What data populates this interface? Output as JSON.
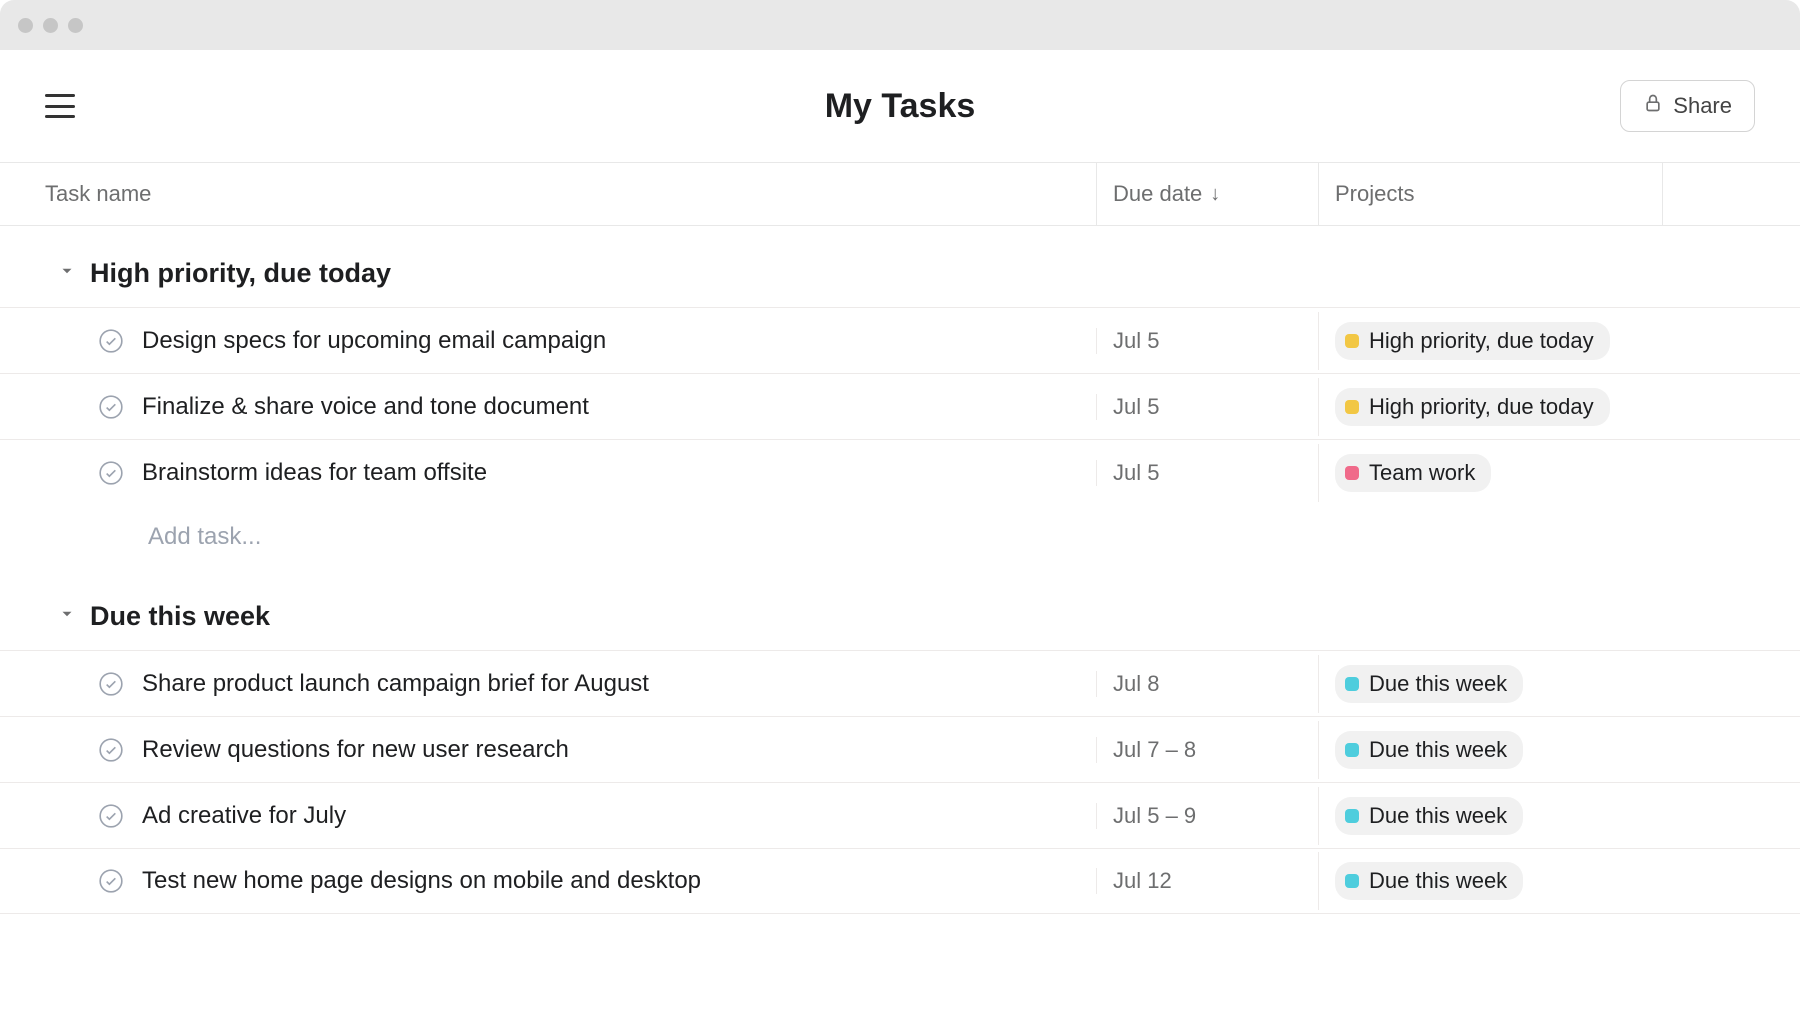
{
  "header": {
    "title": "My Tasks",
    "share_label": "Share"
  },
  "columns": {
    "task_name": "Task name",
    "due_date": "Due date",
    "projects": "Projects"
  },
  "add_task_placeholder": "Add task...",
  "project_colors": {
    "high_priority": "#f2c744",
    "team_work": "#f06a8a",
    "due_this_week": "#4ecddd"
  },
  "sections": [
    {
      "title": "High priority, due today",
      "tasks": [
        {
          "name": "Design specs for upcoming email campaign",
          "due": "Jul 5",
          "project_label": "High priority, due today",
          "project_color_key": "high_priority"
        },
        {
          "name": "Finalize & share voice and tone document",
          "due": "Jul 5",
          "project_label": "High priority, due today",
          "project_color_key": "high_priority"
        },
        {
          "name": "Brainstorm ideas for team offsite",
          "due": "Jul 5",
          "project_label": "Team work",
          "project_color_key": "team_work"
        }
      ]
    },
    {
      "title": "Due this week",
      "tasks": [
        {
          "name": "Share product launch campaign brief for August",
          "due": "Jul 8",
          "project_label": "Due this week",
          "project_color_key": "due_this_week"
        },
        {
          "name": "Review questions for new user research",
          "due": "Jul 7 – 8",
          "project_label": "Due this week",
          "project_color_key": "due_this_week"
        },
        {
          "name": "Ad creative for July",
          "due": "Jul 5 – 9",
          "project_label": "Due this week",
          "project_color_key": "due_this_week"
        },
        {
          "name": "Test new home page designs on mobile and desktop",
          "due": "Jul 12",
          "project_label": "Due this week",
          "project_color_key": "due_this_week"
        }
      ]
    }
  ]
}
